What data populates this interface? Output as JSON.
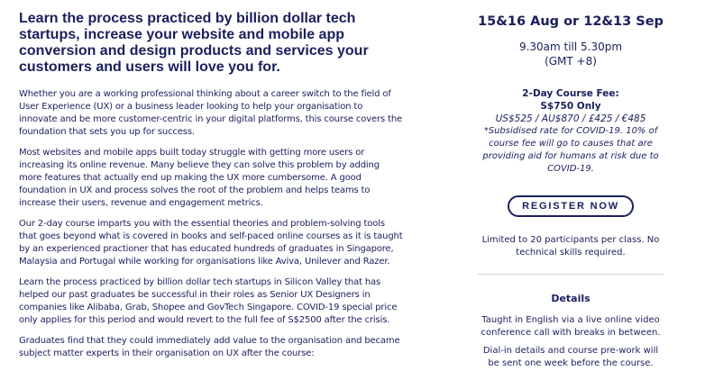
{
  "main": {
    "headline": "Learn the process practiced by billion dollar tech startups, increase your website and mobile app conversion and design products and services your customers and users will love you for.",
    "paragraphs": [
      "Whether you are a working professional thinking about a career switch to the field of User Experience (UX) or a business leader looking to help your organisation to innovate and be more customer-centric in your digital platforms, this course covers the foundation that sets you up for success.",
      "Most websites and mobile apps built today struggle with getting more users or increasing its online revenue. Many believe they can solve this problem by adding more features that actually end up making the UX more cumbersome. A good foundation in UX and process solves the root of the problem and helps teams to increase their users, revenue and engagement metrics.",
      "Our 2-day course imparts you with the essential theories and problem-solving tools that goes beyond what is covered in books and self-paced online courses as it is taught by an experienced practioner that has educated hundreds of graduates in Singapore, Malaysia and Portugal while working for organisations like Aviva, Unilever and Razer.",
      "Learn the process practiced by billion dollar tech startups in Silicon Valley that has helped our past graduates be successful in their roles as Senior UX Designers in companies like Alibaba, Grab, Shopee and GovTech Singapore. COVID-19 special price only applies for this period and would revert to the full fee of S$2500 after the crisis.",
      "Graduates find that they could immediately add value to the organisation and became subject matter experts in their organisation on UX after the course:"
    ]
  },
  "sidebar": {
    "dates": "15&16 Aug or 12&13 Sep",
    "time": "9.30am till 5.30pm",
    "timezone": "(GMT +8)",
    "fee_title": "2-Day Course Fee:",
    "fee_price": "S$750 Only",
    "fee_alt": "US$525 / AU$870 / £425 / €485",
    "fee_note": "*Subsidised rate for COVID-19. 10% of course fee will go to causes that are providing aid for humans at risk due to COVID-19.",
    "register_label": "REGISTER NOW",
    "limit_note": "Limited to 20 participants per class. No technical skills required.",
    "details_title": "Details",
    "details_text": "Taught in English via a live online video conference call with breaks in between.",
    "dialin_text": "Dial-in details and course pre-work will be sent one week before the course."
  }
}
